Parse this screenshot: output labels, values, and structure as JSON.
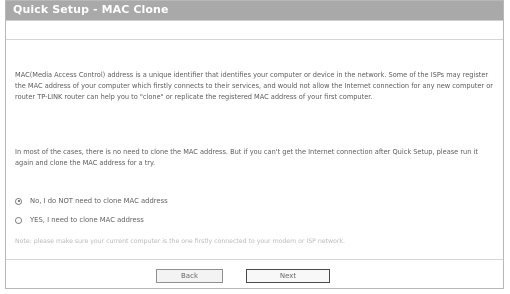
{
  "header": {
    "title": "Quick Setup - MAC Clone"
  },
  "content": {
    "intro": "MAC(Media Access Control) address is a unique identifier that identifies your computer or device in the network. Some of the ISPs may register the MAC address of your computer which firstly connects to their services, and would not allow the Internet connection for any new computer or router TP-LINK router can help you to \"clone\" or replicate the registered MAC address of your first computer.",
    "instruction": "In most of the cases, there is no need to clone the MAC address. But if you can't get the Internet connection after Quick Setup, please run it again and clone the MAC address for a try.",
    "options": [
      {
        "label": "No, I do NOT need to clone MAC address",
        "selected": true
      },
      {
        "label": "YES, I need to clone MAC address",
        "selected": false
      }
    ],
    "note": "Note: please make sure your current computer is the one firstly connected to your modem or ISP network."
  },
  "buttons": {
    "back": "Back",
    "next": "Next"
  },
  "colors": {
    "title_bar": "#a9a9a9",
    "title_text": "#ffffff",
    "border": "#b8b8b8"
  }
}
